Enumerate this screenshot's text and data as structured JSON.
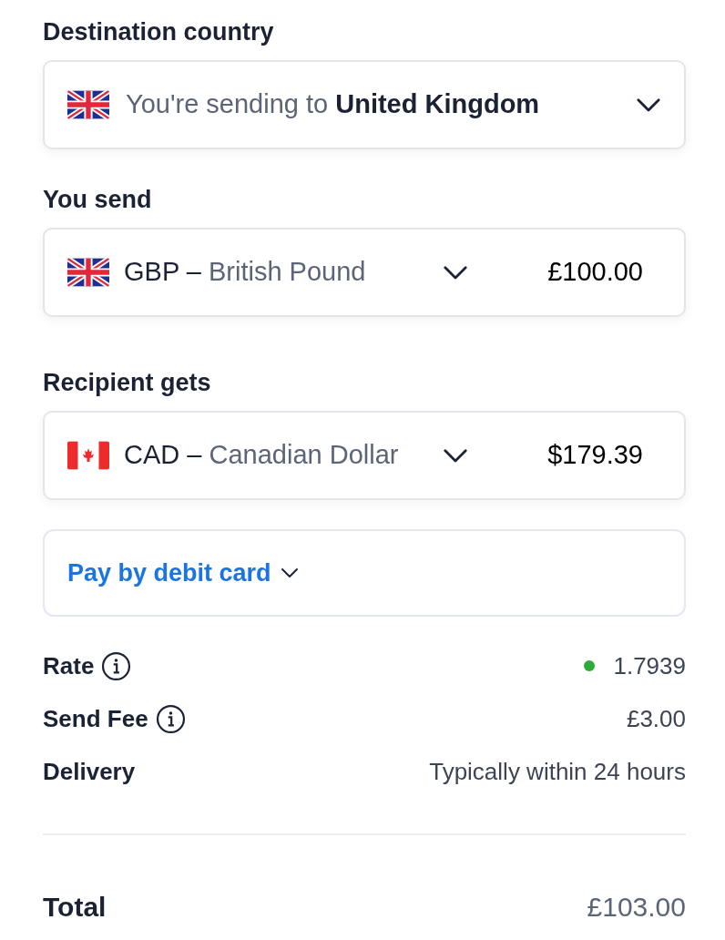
{
  "destination": {
    "label": "Destination country",
    "kind": "uk",
    "prefix": "You're sending to",
    "country": "United Kingdom"
  },
  "amounts": [
    {
      "label": "You send",
      "kind": "uk",
      "code": "GBP –",
      "name": "British Pound",
      "amount": "£100.00"
    },
    {
      "label": "Recipient gets",
      "kind": "ca",
      "code": "CAD –",
      "name": "Canadian Dollar",
      "amount": "$179.39"
    }
  ],
  "payment": {
    "label": "Pay by debit card"
  },
  "details": [
    {
      "label": "Rate",
      "info": true,
      "value": "1.7939",
      "color": "#2eaa3a"
    },
    {
      "label": "Send Fee",
      "info": true,
      "value": "£3.00"
    },
    {
      "label": "Delivery",
      "info": false,
      "value": "Typically within 24 hours"
    }
  ],
  "total": {
    "label": "Total",
    "value": "£103.00"
  }
}
